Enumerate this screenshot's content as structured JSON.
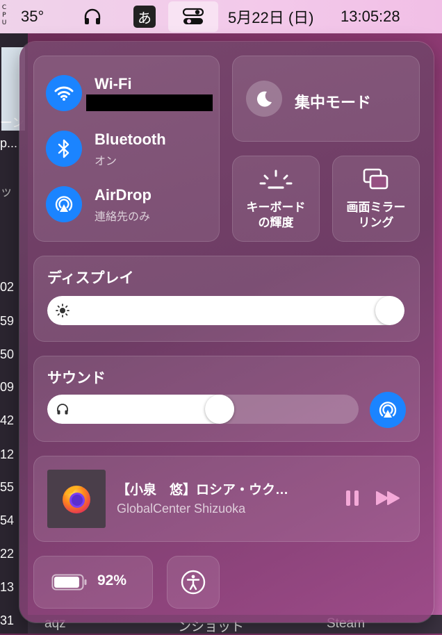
{
  "menubar": {
    "cpu_label": "CPU",
    "temperature": "35°",
    "input_method": "あ",
    "date": "5月22日 (日)",
    "time": "13:05:28"
  },
  "background": {
    "left_fragments": [
      "ーン",
      "p...",
      "ッ",
      "02",
      "59",
      "50",
      "09",
      "42",
      "12",
      "55",
      "54",
      "22",
      "13",
      "31"
    ],
    "bottom_fragments": [
      "aqz",
      "ンショット",
      "Steam"
    ]
  },
  "connectivity": {
    "wifi": {
      "label": "Wi-Fi",
      "status": ""
    },
    "bluetooth": {
      "label": "Bluetooth",
      "status": "オン"
    },
    "airdrop": {
      "label": "AirDrop",
      "status": "連絡先のみ"
    }
  },
  "focus": {
    "label": "集中モード"
  },
  "keyboard_brightness": {
    "label_line1": "キーボード",
    "label_line2": "の輝度"
  },
  "screen_mirroring": {
    "label_line1": "画面ミラー",
    "label_line2": "リング"
  },
  "display": {
    "title": "ディスプレイ",
    "level": 1.0
  },
  "sound": {
    "title": "サウンド",
    "level": 0.56
  },
  "now_playing": {
    "title": "【小泉　悠】ロシア・ウク…",
    "artist": "GlobalCenter Shizuoka"
  },
  "battery": {
    "percent": "92%",
    "level": 0.92
  },
  "colors": {
    "accent": "#1b84ff",
    "player_controls": "#f4a9d8"
  }
}
